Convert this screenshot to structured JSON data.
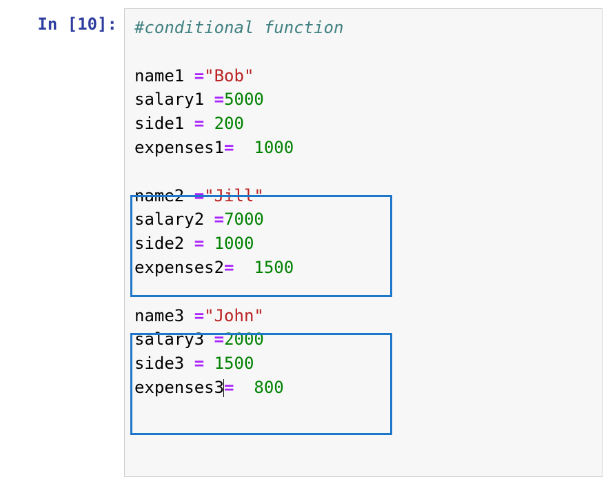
{
  "prompt": {
    "label": "In",
    "open": "[",
    "num": "10",
    "close": "]:",
    "full": "In [10]:"
  },
  "code": {
    "comment": "#conditional function",
    "person1": {
      "name_var": "name1",
      "op1": " =",
      "name_val": "\"Bob\"",
      "sal_var": "salary1",
      "op2": " =",
      "sal_val": "5000",
      "side_var": "side1",
      "op3": " = ",
      "side_val": "200",
      "exp_var": "expenses1",
      "op4": "=  ",
      "exp_val": "1000"
    },
    "person2": {
      "name_var": "name2",
      "op1": " =",
      "name_val": "\"Jill\"",
      "sal_var": "salary2",
      "op2": " =",
      "sal_val": "7000",
      "side_var": "side2",
      "op3": " = ",
      "side_val": "1000",
      "exp_var": "expenses2",
      "op4": "=  ",
      "exp_val": "1500"
    },
    "person3": {
      "name_var": "name3",
      "op1": " =",
      "name_val": "\"John\"",
      "sal_var": "salary3",
      "op2": " =",
      "sal_val": "2000",
      "side_var": "side3",
      "op3": " = ",
      "side_val": "1500",
      "exp_var": "expenses3",
      "op4": "=  ",
      "exp_val": "800"
    }
  }
}
